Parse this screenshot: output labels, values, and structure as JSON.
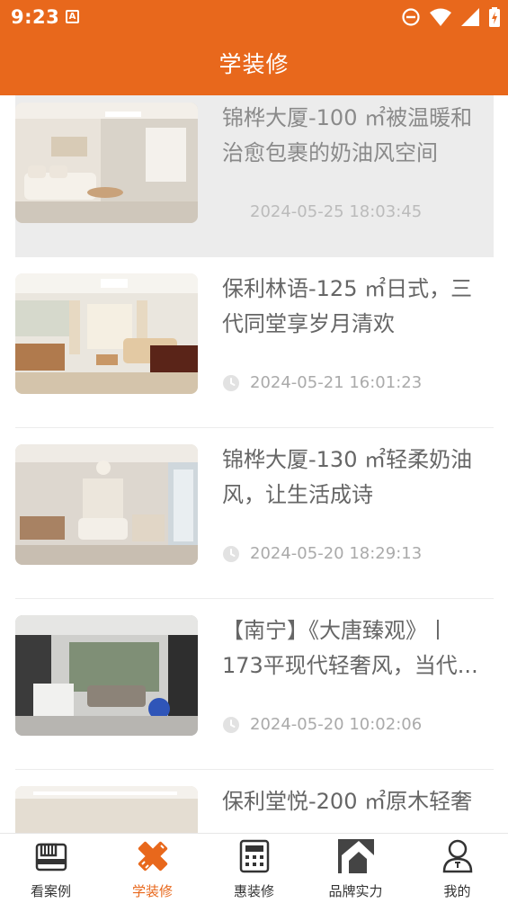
{
  "status_bar": {
    "time": "9:23",
    "notification_badge": "A",
    "icons": [
      "do-not-disturb-icon",
      "wifi-icon",
      "signal-icon",
      "battery-charging-icon"
    ]
  },
  "header": {
    "title": "学装修"
  },
  "articles": [
    {
      "title": "锦桦大厦-100 ㎡被温暖和治愈包裹的奶油风空间",
      "date": "2024-05-25 18:03:45",
      "selected": true
    },
    {
      "title": "保利林语-125 ㎡日式，三代同堂享岁月清欢",
      "date": "2024-05-21 16:01:23",
      "selected": false
    },
    {
      "title": "锦桦大厦-130 ㎡轻柔奶油风，让生活成诗",
      "date": "2024-05-20 18:29:13",
      "selected": false
    },
    {
      "title": "【南宁】《大唐臻观》丨173平现代轻奢风，当代...",
      "date": "2024-05-20 10:02:06",
      "selected": false
    },
    {
      "title": "保利堂悦-200 ㎡原木轻奢",
      "date": "",
      "selected": false
    }
  ],
  "bottom_nav": [
    {
      "label": "看案例",
      "icon": "case-box-icon",
      "active": false
    },
    {
      "label": "学装修",
      "icon": "pencil-ruler-icon",
      "active": true
    },
    {
      "label": "惠装修",
      "icon": "calculator-icon",
      "active": false
    },
    {
      "label": "品牌实力",
      "icon": "house-roof-icon",
      "active": false
    },
    {
      "label": "我的",
      "icon": "user-icon",
      "active": false
    }
  ],
  "colors": {
    "accent": "#e8681c",
    "text": "#666666",
    "date": "#aaaaaa"
  }
}
